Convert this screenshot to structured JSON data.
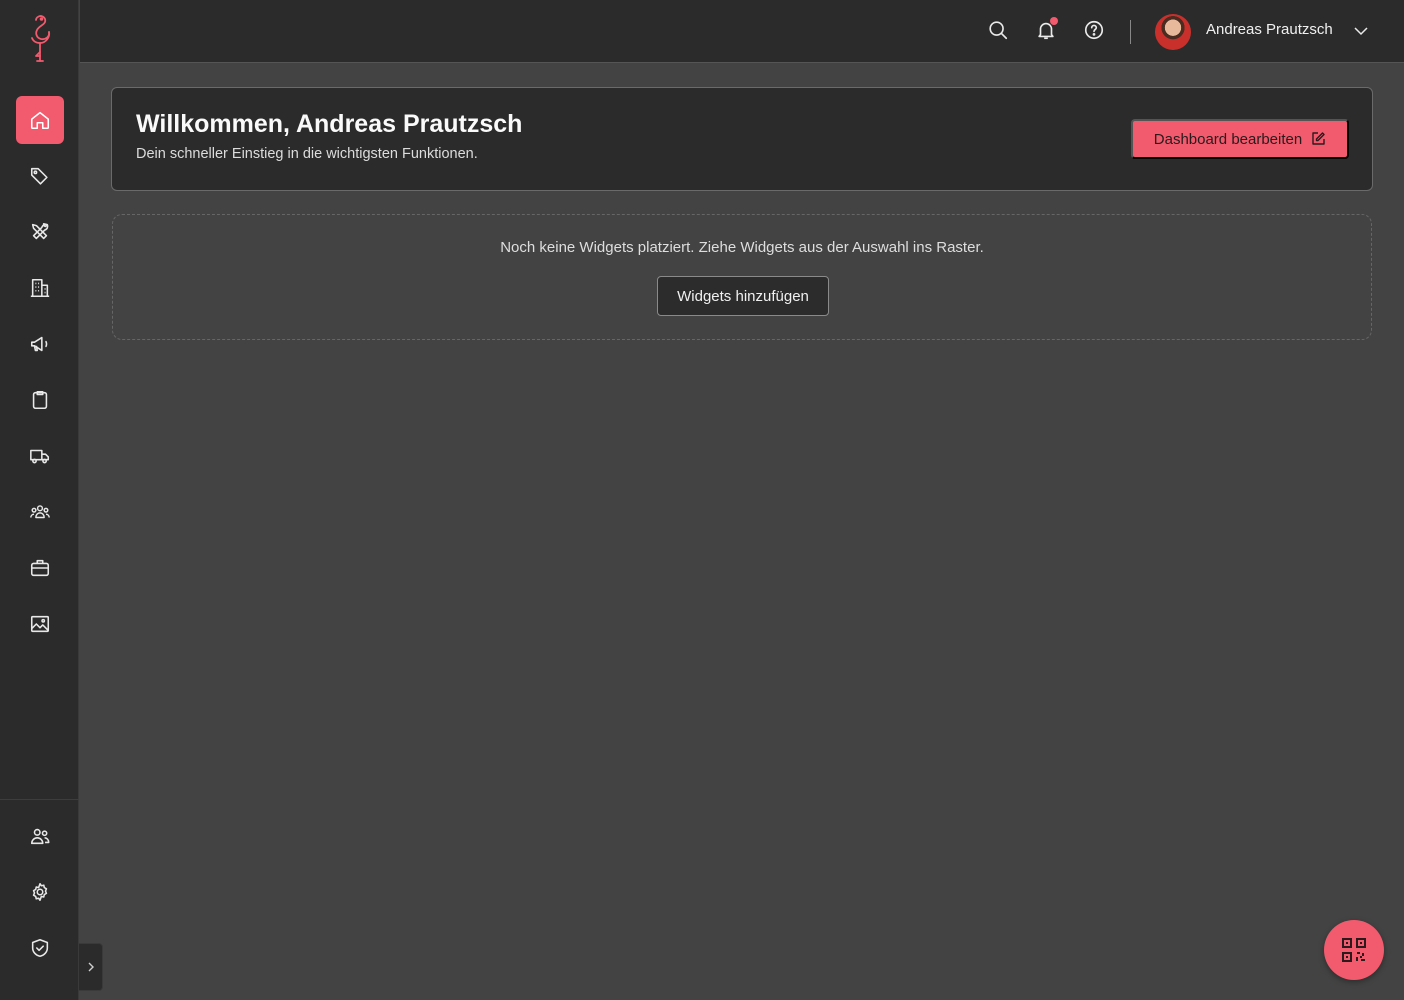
{
  "colors": {
    "accent": "#f25a6e",
    "sidebar_bg": "#2b2b2b",
    "page_bg": "#434343"
  },
  "sidebar": {
    "logo_icon": "flamingo-logo-icon",
    "nav_items": [
      {
        "icon": "home-icon",
        "active": true
      },
      {
        "icon": "tag-icon"
      },
      {
        "icon": "tools-icon"
      },
      {
        "icon": "building-icon"
      },
      {
        "icon": "megaphone-icon"
      },
      {
        "icon": "clipboard-icon"
      },
      {
        "icon": "truck-icon"
      },
      {
        "icon": "team-icon"
      },
      {
        "icon": "briefcase-icon"
      },
      {
        "icon": "image-icon"
      }
    ],
    "bottom_items": [
      {
        "icon": "users-icon"
      },
      {
        "icon": "settings-gear-icon"
      },
      {
        "icon": "shield-check-icon"
      }
    ],
    "collapse_icon": "chevron-right-icon"
  },
  "header": {
    "icons": [
      "search-icon",
      "bell-icon",
      "help-icon"
    ],
    "notification_dot": true,
    "user_name": "Andreas Prautzsch",
    "user_menu_icon": "chevron-down-icon"
  },
  "welcome": {
    "title": "Willkommen, Andreas Prautzsch",
    "subtitle": "Dein schneller Einstieg in die wichtigsten Funktionen.",
    "edit_button_label": "Dashboard bearbeiten",
    "edit_button_icon": "edit-icon"
  },
  "widgets": {
    "empty_message": "Noch keine Widgets platziert. Ziehe Widgets aus der Auswahl ins Raster.",
    "add_button_label": "Widgets hinzufügen"
  },
  "fab": {
    "icon": "qr-code-icon"
  }
}
